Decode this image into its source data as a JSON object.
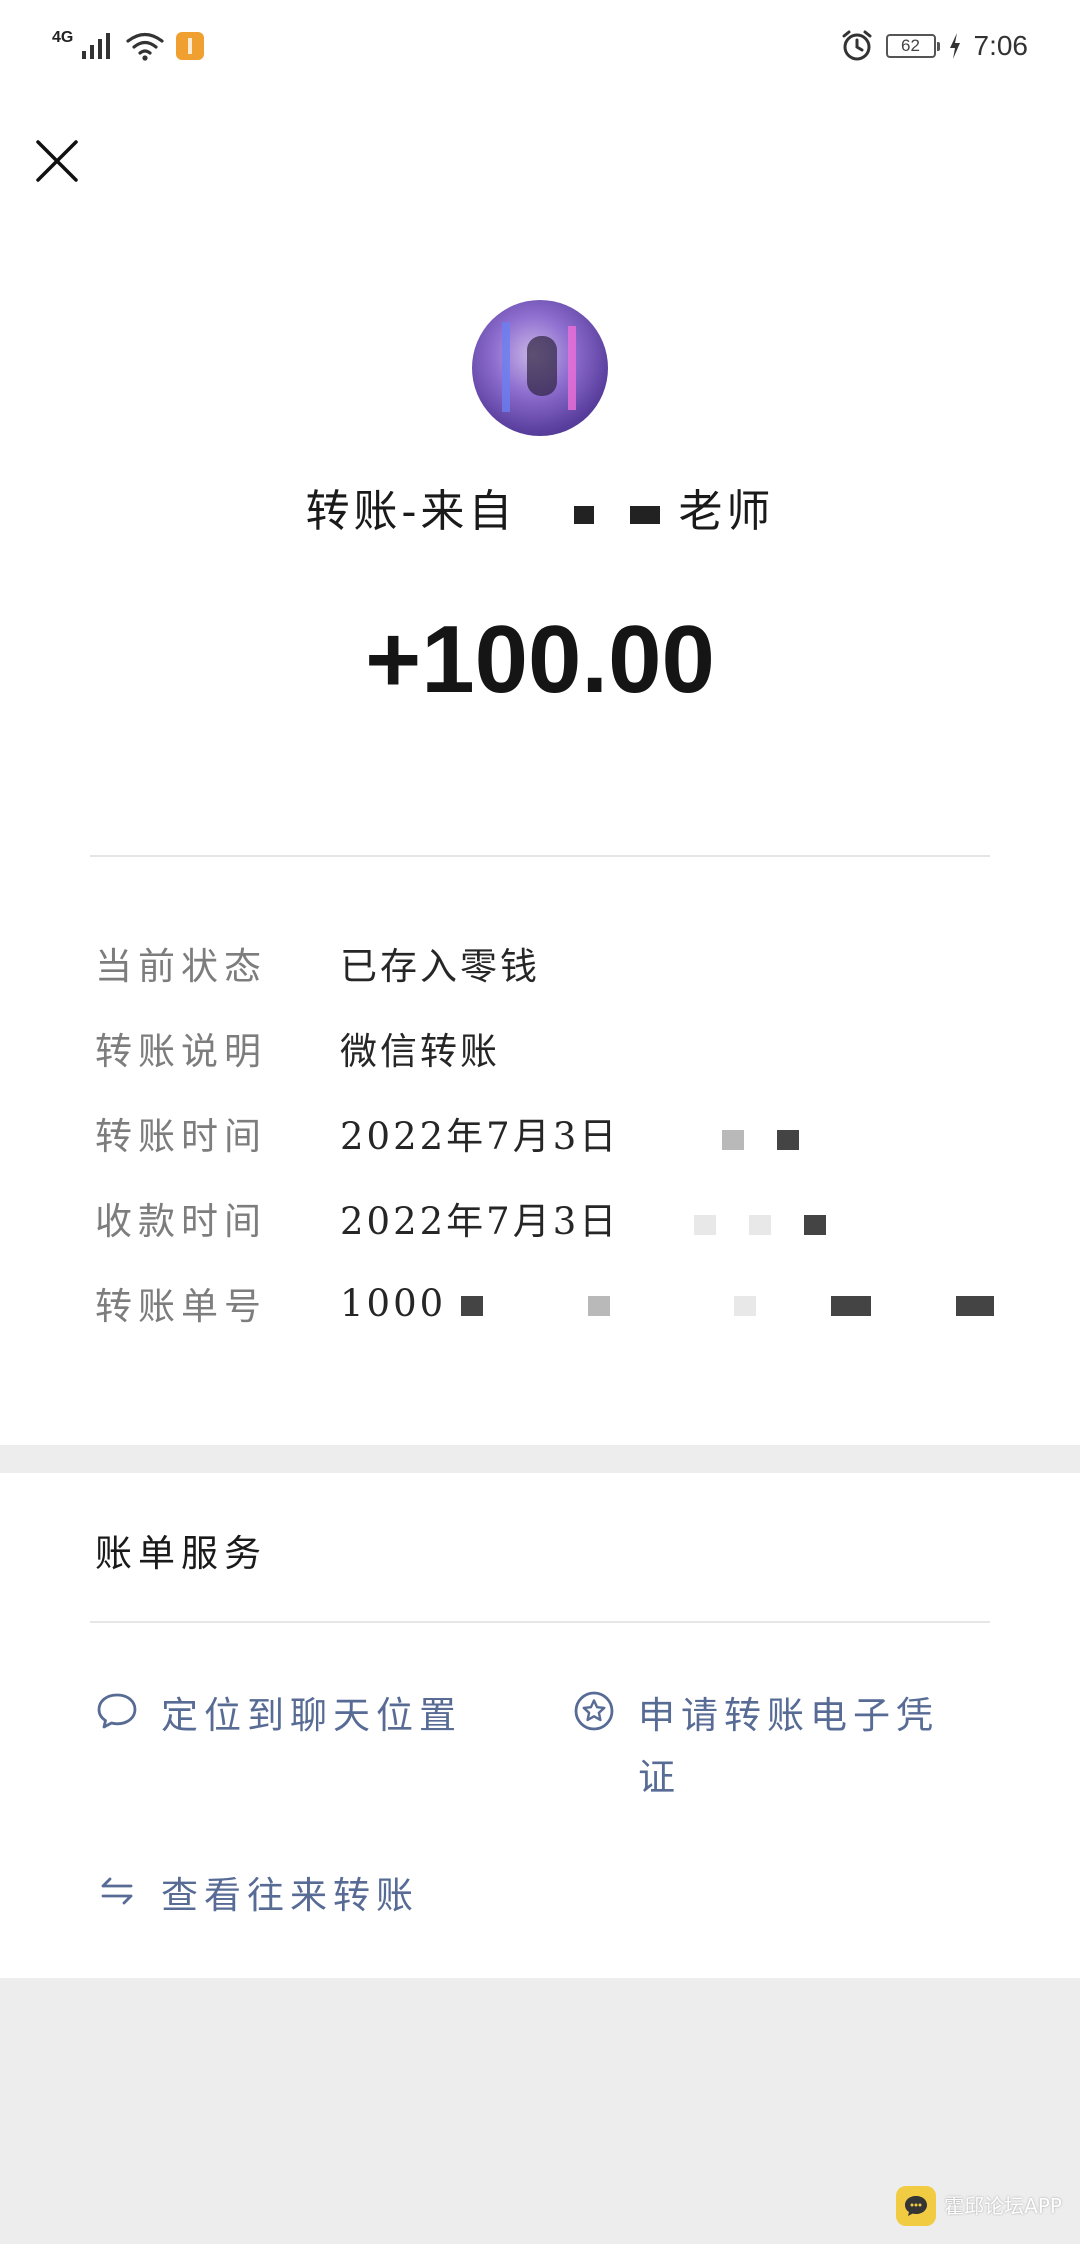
{
  "status_bar": {
    "network": "4G",
    "battery": "62",
    "time": "7:06"
  },
  "header": {
    "close_icon": "close-icon"
  },
  "transfer": {
    "title": "转账-来自",
    "title_suffix": "老师",
    "amount": "+100.00",
    "details": [
      {
        "label": "当前状态",
        "value": "已存入零钱"
      },
      {
        "label": "转账说明",
        "value": "微信转账"
      },
      {
        "label": "转账时间",
        "value": "2022年7月3日"
      },
      {
        "label": "收款时间",
        "value": "2022年7月3日"
      },
      {
        "label": "转账单号",
        "value": "1000"
      }
    ]
  },
  "bill_services": {
    "title": "账单服务",
    "locate_chat": "定位到聊天位置",
    "apply_voucher": "申请转账电子凭证",
    "view_transfers": "查看往来转账"
  },
  "watermark": {
    "text": "霍邱论坛APP"
  },
  "colors": {
    "link": "#576b95",
    "label_gray": "#7d7d7d",
    "background": "#ededed",
    "watermark_logo": "#f2c830"
  }
}
